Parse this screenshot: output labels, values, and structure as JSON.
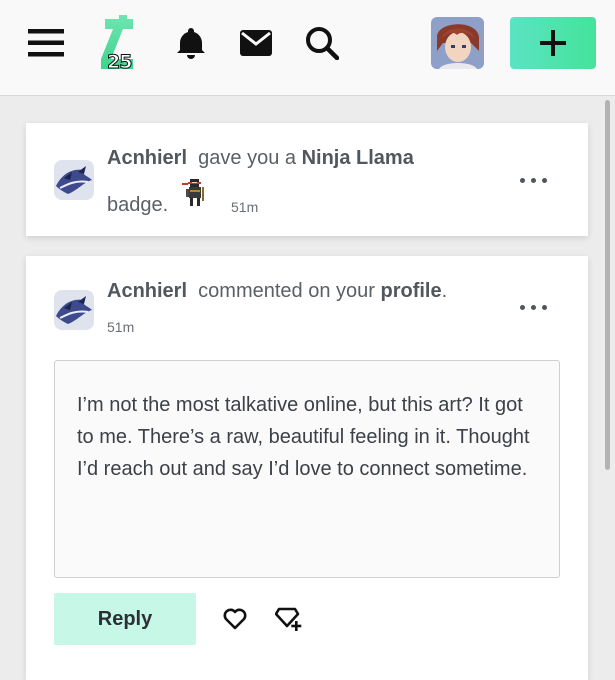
{
  "header": {
    "logo_number": "25",
    "icons": [
      "menu-icon",
      "bell-icon",
      "mail-icon",
      "search-icon",
      "plus-icon"
    ],
    "accent_colors": [
      "#5be3c4",
      "#44e39a"
    ]
  },
  "notifications": [
    {
      "username": "Acnhierl",
      "action_text": "gave you a",
      "badge_name": "Ninja Llama",
      "badge_suffix": "badge.",
      "time": "51m"
    },
    {
      "username": "Acnhierl",
      "action_text": "commented on your",
      "target": "profile",
      "target_suffix": ".",
      "time": "51m",
      "comment": "I’m not the most talkative online, but this art? It got to me. There’s a raw, beautiful feeling in it. Thought I’d reach out and say I’d love to connect sometime.",
      "reply_label": "Reply"
    }
  ]
}
